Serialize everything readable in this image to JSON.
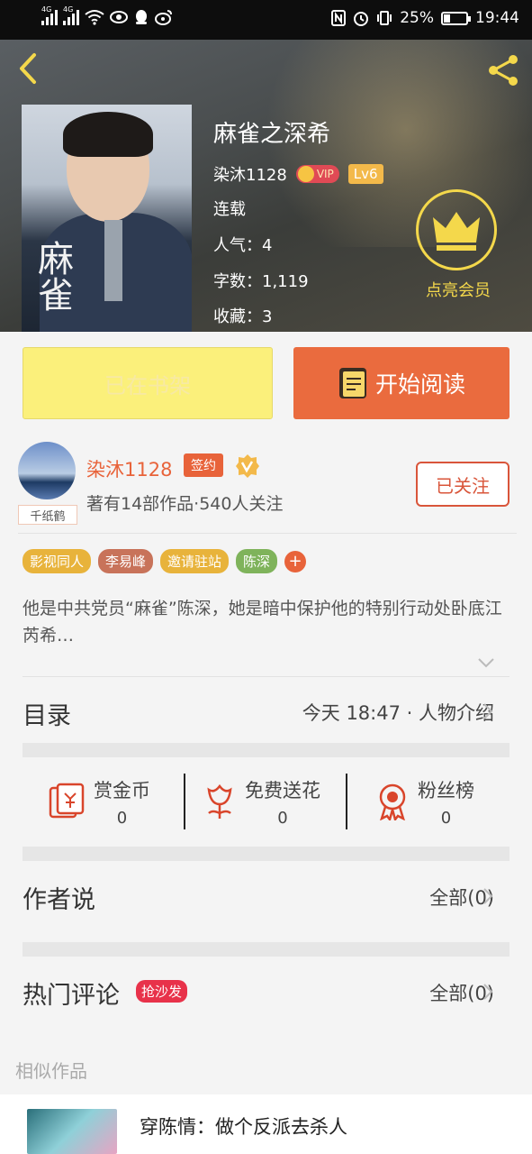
{
  "status_bar": {
    "network_left": "4G",
    "network_right": "4G",
    "battery": "25%",
    "time": "19:44"
  },
  "book": {
    "title": "麻雀之深希",
    "author": "染沐1128",
    "vip_label": "VIP",
    "level": "Lv6",
    "status": "连载",
    "popularity": "人气：4",
    "word_count": "字数：1,119",
    "favorites": "收藏：3",
    "cover_art_text": "麻雀"
  },
  "member": {
    "label": "点亮会员"
  },
  "actions": {
    "shelf": "已在书架",
    "read": "开始阅读"
  },
  "author_card": {
    "name": "染沐1128",
    "signed": "签约",
    "avatar_tag": "千纸鹤",
    "stats": "著有14部作品·540人关注",
    "follow": "已关注"
  },
  "tags": [
    {
      "label": "影视同人",
      "color": "#e8b33b"
    },
    {
      "label": "李易峰",
      "color": "#c8735a"
    },
    {
      "label": "邀请驻站",
      "color": "#e8b33b"
    },
    {
      "label": "陈深",
      "color": "#7fb35b"
    }
  ],
  "tag_add": "+",
  "synopsis": "他是中共党员“麻雀”陈深，她是暗中保护他的特别行动处卧底江芮希…",
  "catalog": {
    "title": "目录",
    "latest": "今天 18:47 · 人物介绍"
  },
  "rewards": [
    {
      "label": "赏金币",
      "value": "0"
    },
    {
      "label": "免费送花",
      "value": "0"
    },
    {
      "label": "粉丝榜",
      "value": "0"
    }
  ],
  "author_says": {
    "title": "作者说",
    "all": "全部(0)"
  },
  "hot_comments": {
    "title": "热门评论",
    "badge": "抢沙发",
    "all": "全部(0)"
  },
  "similar": {
    "label": "相似作品",
    "first_title": "穿陈情：做个反派去杀人"
  },
  "colors": {
    "accent": "#ea6b3e",
    "gold": "#f4d84b",
    "shelf_yellow": "#fbf07b"
  }
}
